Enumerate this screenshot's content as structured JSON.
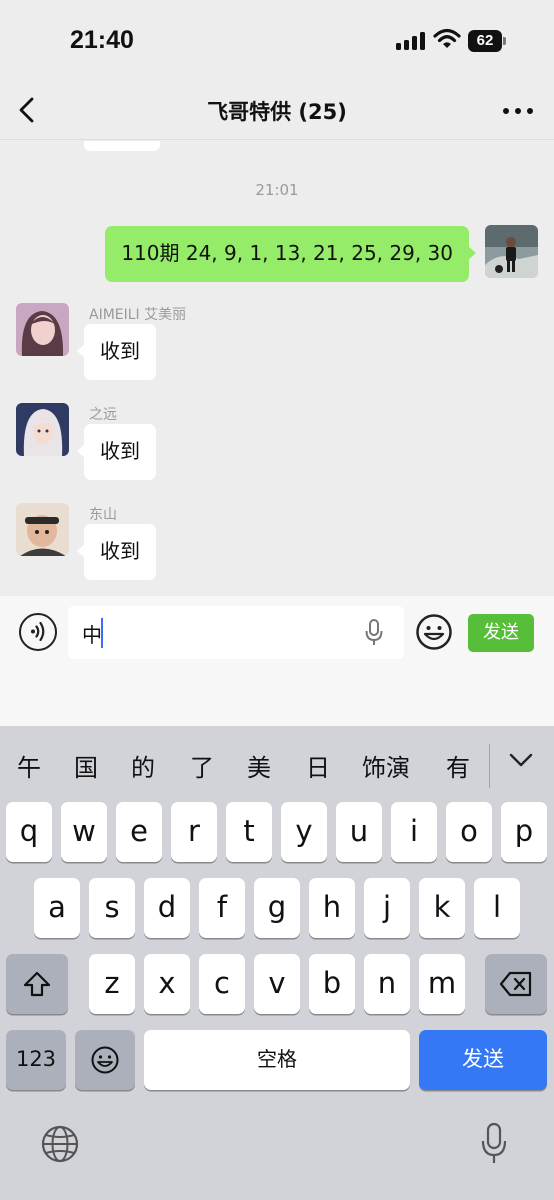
{
  "status_bar": {
    "time": "21:40",
    "battery": "62"
  },
  "nav": {
    "title": "飞哥特供 (25)"
  },
  "chat": {
    "timestamp": "21:01",
    "outgoing": {
      "text": "110期 24, 9, 1, 13, 21, 25, 29, 30"
    },
    "incoming": [
      {
        "sender": "AIMEILI 艾美丽",
        "text": "收到"
      },
      {
        "sender": "之远",
        "text": "收到"
      },
      {
        "sender": "东山",
        "text": "收到"
      }
    ]
  },
  "input": {
    "value": "中",
    "send_label": "发送"
  },
  "keyboard": {
    "candidates": [
      "午",
      "国",
      "的",
      "了",
      "美",
      "日",
      "饰演",
      "有"
    ],
    "row1": [
      "q",
      "w",
      "e",
      "r",
      "t",
      "y",
      "u",
      "i",
      "o",
      "p"
    ],
    "row2": [
      "a",
      "s",
      "d",
      "f",
      "g",
      "h",
      "j",
      "k",
      "l"
    ],
    "row3": [
      "z",
      "x",
      "c",
      "v",
      "b",
      "n",
      "m"
    ],
    "numbers_label": "123",
    "space_label": "空格",
    "send_label": "发送"
  },
  "icons": {
    "back": "chevron-left-icon",
    "more": "more-dots-icon",
    "voice": "voice-icon",
    "mic": "microphone-icon",
    "emoji": "emoji-icon",
    "shift": "shift-icon",
    "delete": "delete-icon",
    "globe": "globe-icon",
    "dictation": "microphone-icon"
  },
  "colors": {
    "outgoing_bubble": "#95ec69",
    "send_button": "#57be3a",
    "keyboard_send": "#3478f6"
  }
}
